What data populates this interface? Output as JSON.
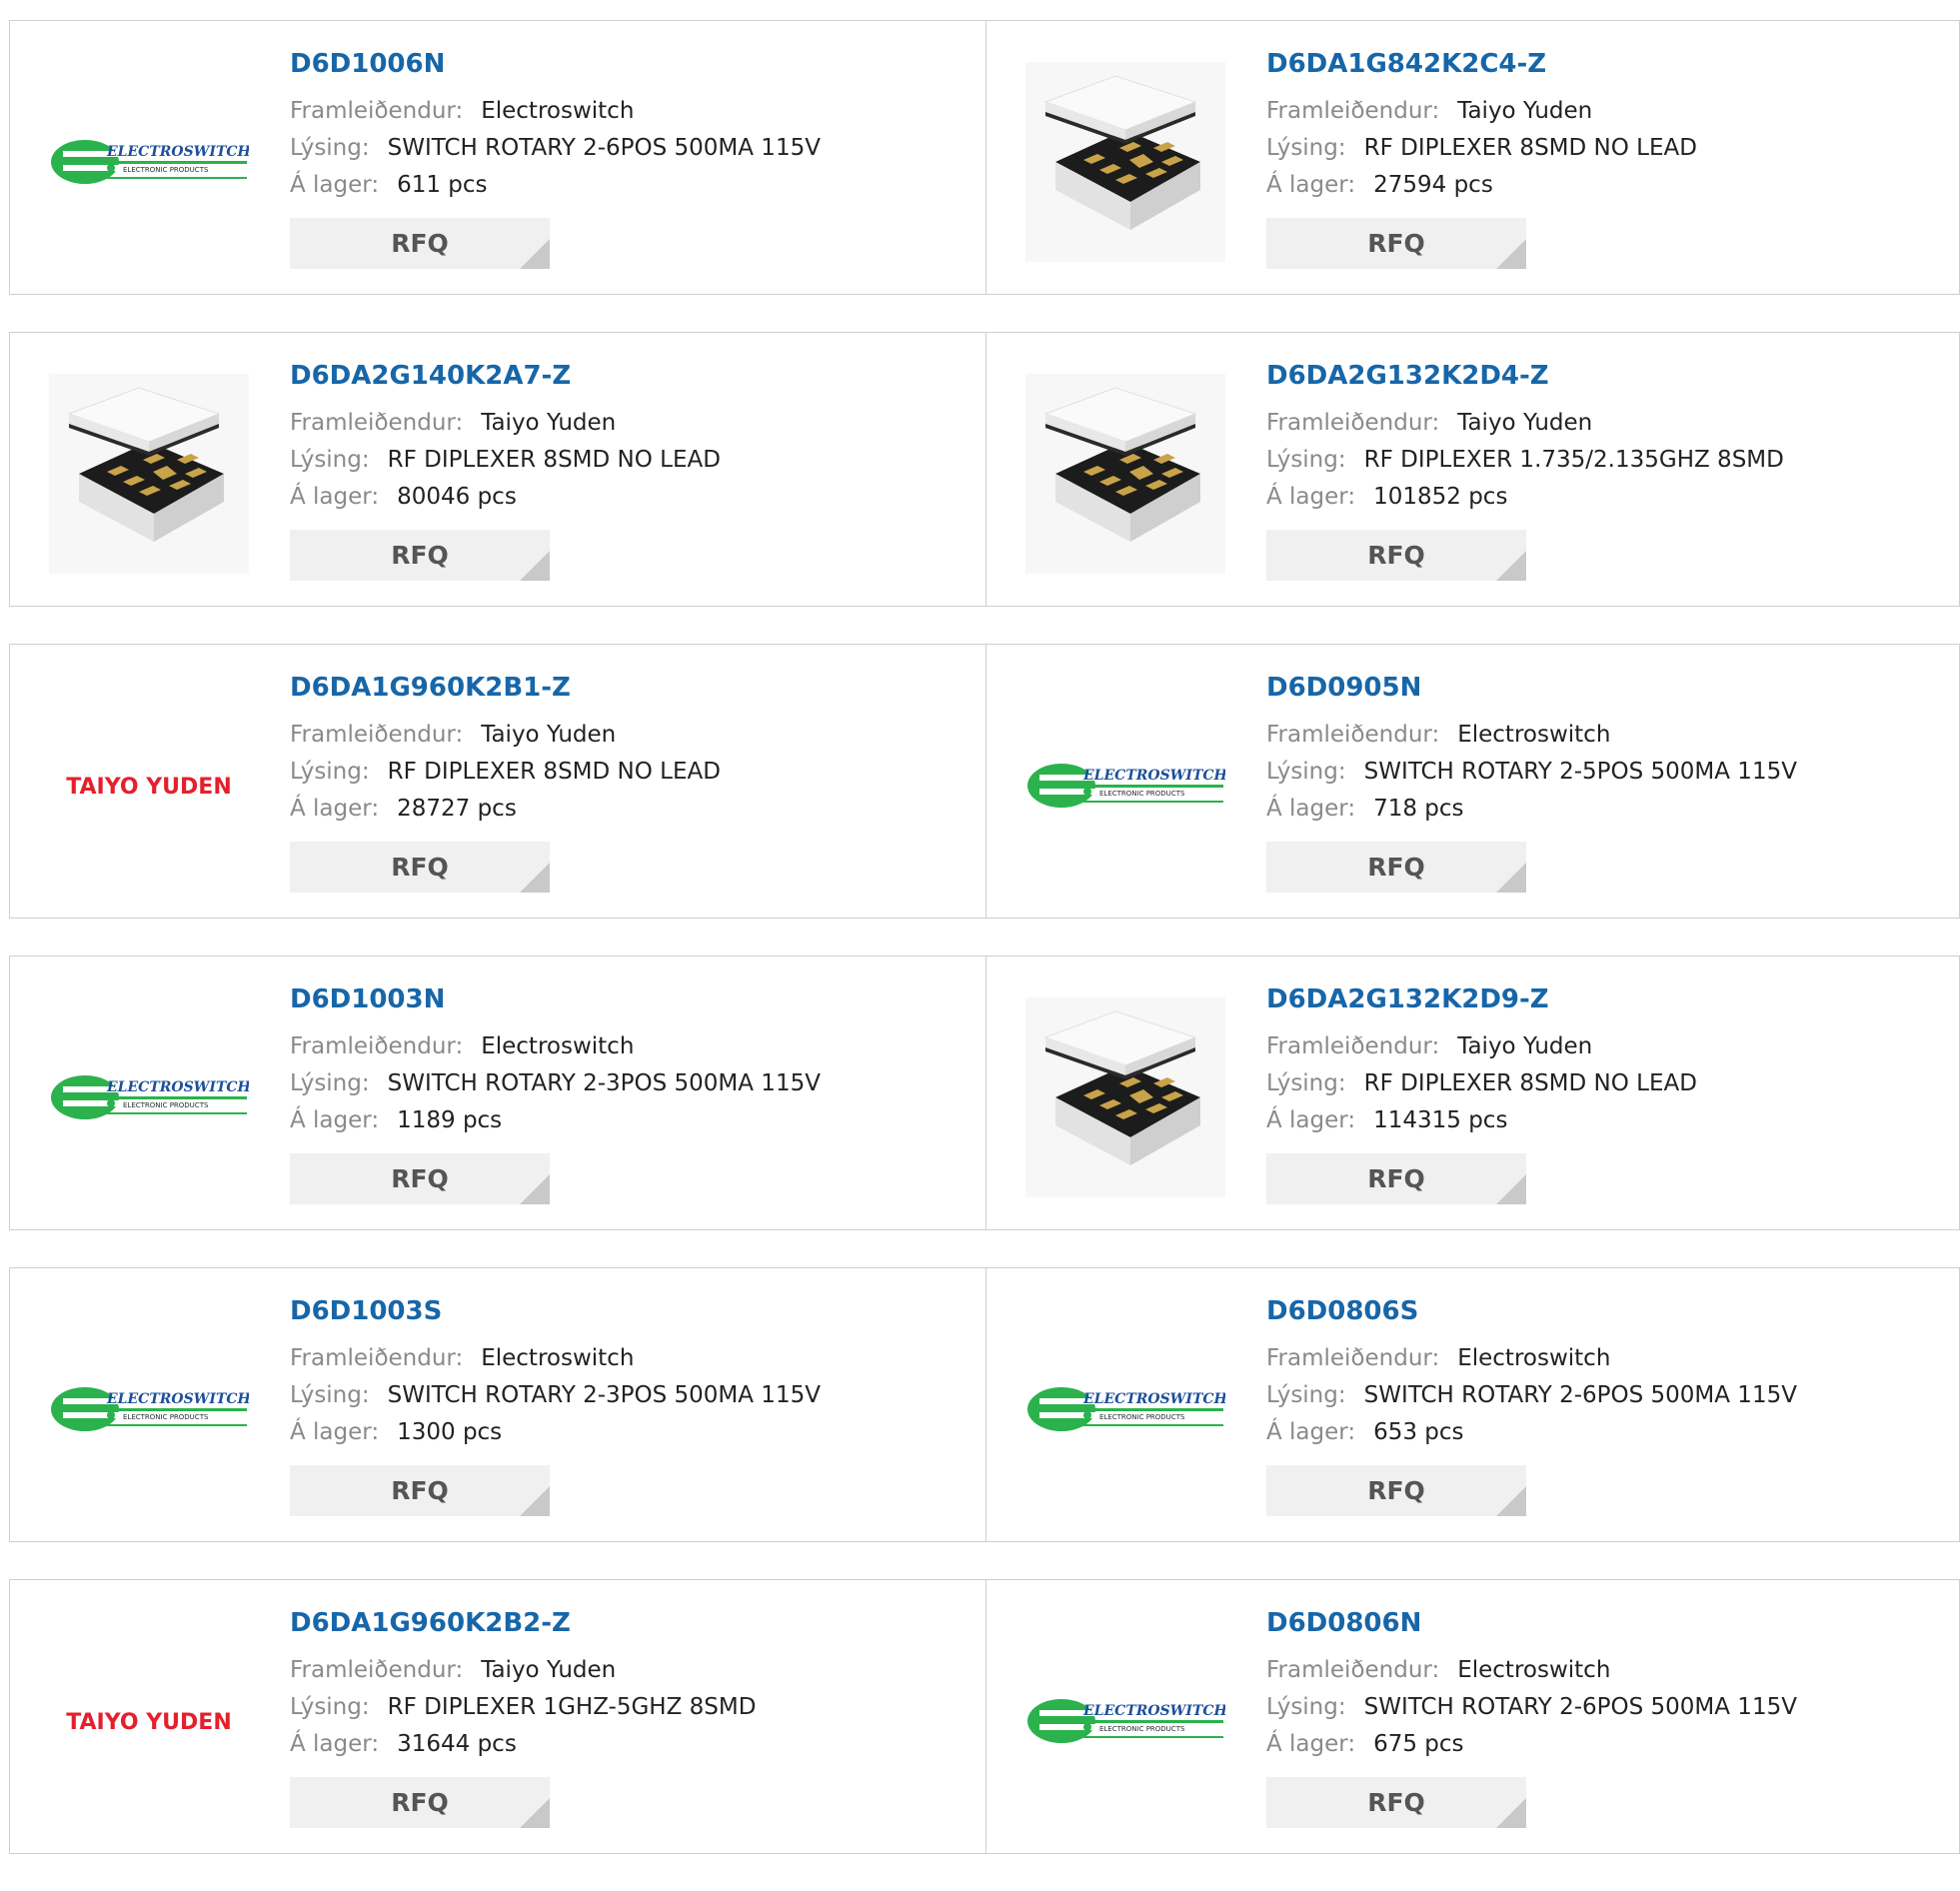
{
  "labels": {
    "manufacturer": "Framleiðendur:",
    "description": "Lýsing:",
    "stock": "Á lager:",
    "rfq": "RFQ"
  },
  "logos": {
    "electroswitch": {
      "name": "ELECTROSWITCH",
      "sub": "ELECTRONIC PRODUCTS"
    },
    "taiyo": {
      "name": "TAIYO YUDEN"
    }
  },
  "colors": {
    "part_link": "#1766a8",
    "electroswitch_green": "#2bb24c",
    "taiyo_red": "#e4202c"
  },
  "products": [
    {
      "pn": "D6D1006N",
      "manufacturer": "Electroswitch",
      "description": "SWITCH ROTARY 2-6POS 500MA 115V",
      "stock": "611 pcs",
      "image": "electroswitch-logo"
    },
    {
      "pn": "D6DA1G842K2C4-Z",
      "manufacturer": "Taiyo Yuden",
      "description": "RF DIPLEXER 8SMD NO LEAD",
      "stock": "27594 pcs",
      "image": "chip"
    },
    {
      "pn": "D6DA2G140K2A7-Z",
      "manufacturer": "Taiyo Yuden",
      "description": "RF DIPLEXER 8SMD NO LEAD",
      "stock": "80046 pcs",
      "image": "chip"
    },
    {
      "pn": "D6DA2G132K2D4-Z",
      "manufacturer": "Taiyo Yuden",
      "description": "RF DIPLEXER 1.735/2.135GHZ 8SMD",
      "stock": "101852 pcs",
      "image": "chip"
    },
    {
      "pn": "D6DA1G960K2B1-Z",
      "manufacturer": "Taiyo Yuden",
      "description": "RF DIPLEXER 8SMD NO LEAD",
      "stock": "28727 pcs",
      "image": "taiyo-logo"
    },
    {
      "pn": "D6D0905N",
      "manufacturer": "Electroswitch",
      "description": "SWITCH ROTARY 2-5POS 500MA 115V",
      "stock": "718 pcs",
      "image": "electroswitch-logo"
    },
    {
      "pn": "D6D1003N",
      "manufacturer": "Electroswitch",
      "description": "SWITCH ROTARY 2-3POS 500MA 115V",
      "stock": "1189 pcs",
      "image": "electroswitch-logo"
    },
    {
      "pn": "D6DA2G132K2D9-Z",
      "manufacturer": "Taiyo Yuden",
      "description": "RF DIPLEXER 8SMD NO LEAD",
      "stock": "114315 pcs",
      "image": "chip"
    },
    {
      "pn": "D6D1003S",
      "manufacturer": "Electroswitch",
      "description": "SWITCH ROTARY 2-3POS 500MA 115V",
      "stock": "1300 pcs",
      "image": "electroswitch-logo"
    },
    {
      "pn": "D6D0806S",
      "manufacturer": "Electroswitch",
      "description": "SWITCH ROTARY 2-6POS 500MA 115V",
      "stock": "653 pcs",
      "image": "electroswitch-logo"
    },
    {
      "pn": "D6DA1G960K2B2-Z",
      "manufacturer": "Taiyo Yuden",
      "description": "RF DIPLEXER 1GHZ-5GHZ 8SMD",
      "stock": "31644 pcs",
      "image": "taiyo-logo"
    },
    {
      "pn": "D6D0806N",
      "manufacturer": "Electroswitch",
      "description": "SWITCH ROTARY 2-6POS 500MA 115V",
      "stock": "675 pcs",
      "image": "electroswitch-logo"
    }
  ]
}
